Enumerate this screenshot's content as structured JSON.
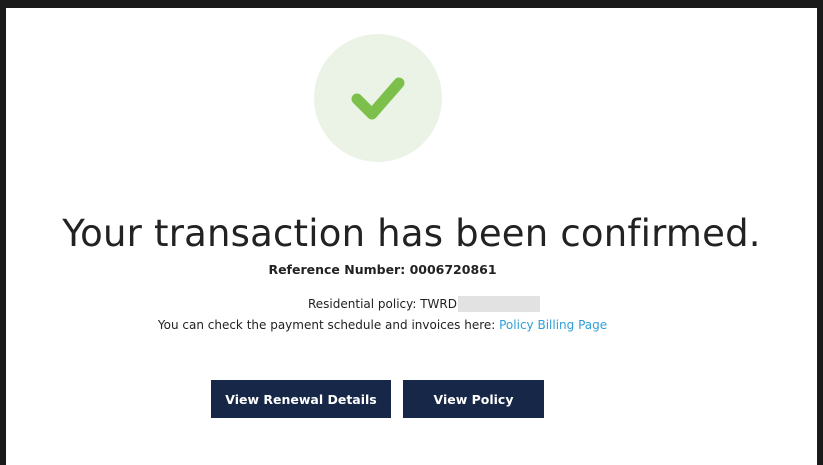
{
  "confirmation": {
    "headline": "Your transaction has been confirmed.",
    "reference": "Reference Number: 0006720861"
  },
  "policy": {
    "label": "Residential policy: TWRD"
  },
  "billing": {
    "text": "You can check the payment schedule and invoices here: ",
    "link_label": "Policy Billing Page"
  },
  "actions": {
    "view_renewal_label": "View Renewal Details",
    "view_policy_label": "View Policy"
  },
  "icons": {
    "status": "checkmark-icon"
  },
  "colors": {
    "success_green": "#7cc04b",
    "success_circle_bg": "#ebf3e6",
    "button_navy": "#162748",
    "link_blue": "#2f9fd8"
  }
}
